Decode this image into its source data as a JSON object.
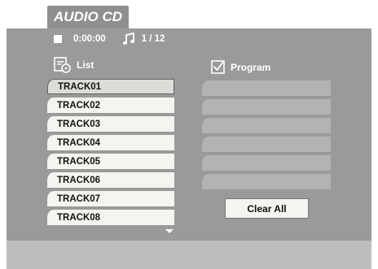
{
  "tab_label": "AUDIO CD",
  "status": {
    "time": "0:00:00",
    "track_counter": "1 / 12"
  },
  "list_header": "List",
  "program_header": "Program",
  "tracks": [
    "TRACK01",
    "TRACK02",
    "TRACK03",
    "TRACK04",
    "TRACK05",
    "TRACK06",
    "TRACK07",
    "TRACK08"
  ],
  "selected_track": "TRACK01",
  "clear_all_label": "Clear All",
  "icons": {
    "stop": "stop-icon",
    "music": "music-note-icon",
    "list": "disc-list-icon",
    "program": "checkbox-icon",
    "scroll": "scroll-down-arrow-icon"
  },
  "colors": {
    "panel": "#9a9a9a",
    "tab": "#8f8f8f",
    "track_bg": "#f4f4f0",
    "program_slot": "#b3b3b3",
    "footer": "#bdbdbd"
  }
}
